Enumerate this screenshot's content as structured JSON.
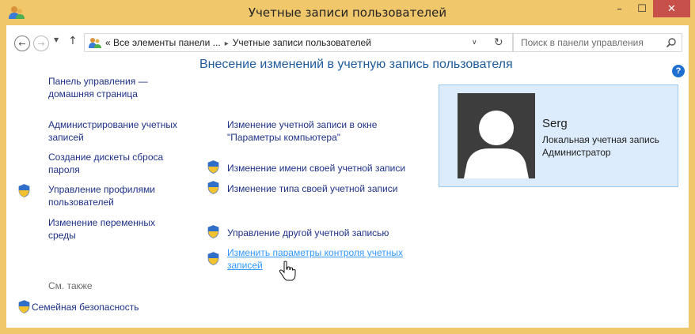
{
  "window": {
    "title": "Учетные записи пользователей",
    "minimize_glyph": "–",
    "maximize_glyph": "☐",
    "close_glyph": "✕"
  },
  "nav": {
    "back_glyph": "←",
    "forward_glyph": "→",
    "dropdown_glyph": "▼",
    "up_glyph": "↑",
    "breadcrumb_prefix": "«",
    "breadcrumbs": [
      "Все элементы панели ...",
      "Учетные записи пользователей"
    ],
    "breadcrumb_separator": "▸",
    "address_dropdown_glyph": "∨",
    "refresh_glyph": "↻",
    "search_placeholder": "Поиск в панели управления"
  },
  "sidebar": {
    "items": [
      {
        "label_line1": "Панель управления —",
        "label_line2": "домашняя страница",
        "shield": false
      },
      {
        "label_line1": "Администрирование учетных",
        "label_line2": "записей",
        "shield": false
      },
      {
        "label_line1": "Создание дискеты сброса",
        "label_line2": "пароля",
        "shield": false
      },
      {
        "label_line1": "Управление профилями",
        "label_line2": "пользователей",
        "shield": true
      },
      {
        "label_line1": "Изменение переменных",
        "label_line2": "среды",
        "shield": false
      }
    ],
    "see_also_label": "См. также",
    "see_also_items": [
      {
        "label": "Семейная безопасность",
        "shield": true
      }
    ]
  },
  "main": {
    "heading": "Внесение изменений в учетную запись пользователя",
    "links": [
      {
        "line1": "Изменение учетной записи в окне",
        "line2": "\"Параметры компьютера\"",
        "shield": false
      },
      {
        "line1": "Изменение имени своей учетной записи",
        "line2": "",
        "shield": true
      },
      {
        "line1": "Изменение типа своей учетной записи",
        "line2": "",
        "shield": true
      },
      {
        "line1": "Управление другой учетной записью",
        "line2": "",
        "shield": true
      },
      {
        "line1": "Изменить параметры контроля учетных",
        "line2": "записей",
        "shield": true,
        "hovered": true
      }
    ],
    "help_glyph": "?"
  },
  "user_card": {
    "name": "Serg",
    "account_type": "Локальная учетная запись",
    "role": "Администратор"
  },
  "colors": {
    "frame": "#f1c76c",
    "close_button": "#c7504a",
    "link": "#1e3287",
    "link_hover": "#3399ff",
    "heading": "#1e5b9b",
    "card_bg": "#dcecfc",
    "card_border": "#9cc9ec",
    "avatar_bg": "#3d3d3d"
  },
  "icons": [
    "users-icon",
    "back-arrow-icon",
    "forward-arrow-icon",
    "up-arrow-icon",
    "refresh-icon",
    "search-icon",
    "shield-icon",
    "help-icon",
    "hand-cursor-icon"
  ]
}
